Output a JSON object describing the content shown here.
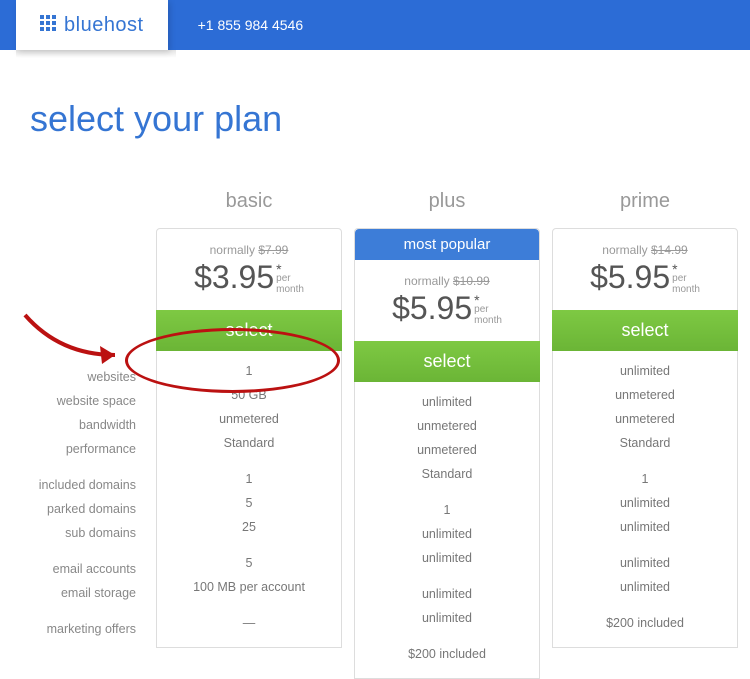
{
  "header": {
    "logo_text": "bluehost",
    "phone": "+1 855 984 4546"
  },
  "title": "select your plan",
  "feature_labels": [
    [
      "websites",
      "website space",
      "bandwidth",
      "performance"
    ],
    [
      "included domains",
      "parked domains",
      "sub domains"
    ],
    [
      "email accounts",
      "email storage"
    ],
    [
      "marketing offers"
    ]
  ],
  "plans": [
    {
      "name": "basic",
      "badge": null,
      "normally_label": "normally",
      "normally_price": "$7.99",
      "price": "$3.95",
      "per": "per",
      "month": "month",
      "select_label": "select",
      "features": [
        [
          "1",
          "50 GB",
          "unmetered",
          "Standard"
        ],
        [
          "1",
          "5",
          "25"
        ],
        [
          "5",
          "100 MB per account"
        ],
        [
          "—"
        ]
      ]
    },
    {
      "name": "plus",
      "badge": "most popular",
      "normally_label": "normally",
      "normally_price": "$10.99",
      "price": "$5.95",
      "per": "per",
      "month": "month",
      "select_label": "select",
      "features": [
        [
          "unlimited",
          "unmetered",
          "unmetered",
          "Standard"
        ],
        [
          "1",
          "unlimited",
          "unlimited"
        ],
        [
          "unlimited",
          "unlimited"
        ],
        [
          "$200 included"
        ]
      ]
    },
    {
      "name": "prime",
      "badge": null,
      "normally_label": "normally",
      "normally_price": "$14.99",
      "price": "$5.95",
      "per": "per",
      "month": "month",
      "select_label": "select",
      "features": [
        [
          "unlimited",
          "unmetered",
          "unmetered",
          "Standard"
        ],
        [
          "1",
          "unlimited",
          "unlimited"
        ],
        [
          "unlimited",
          "unlimited"
        ],
        [
          "$200 included"
        ]
      ]
    }
  ]
}
